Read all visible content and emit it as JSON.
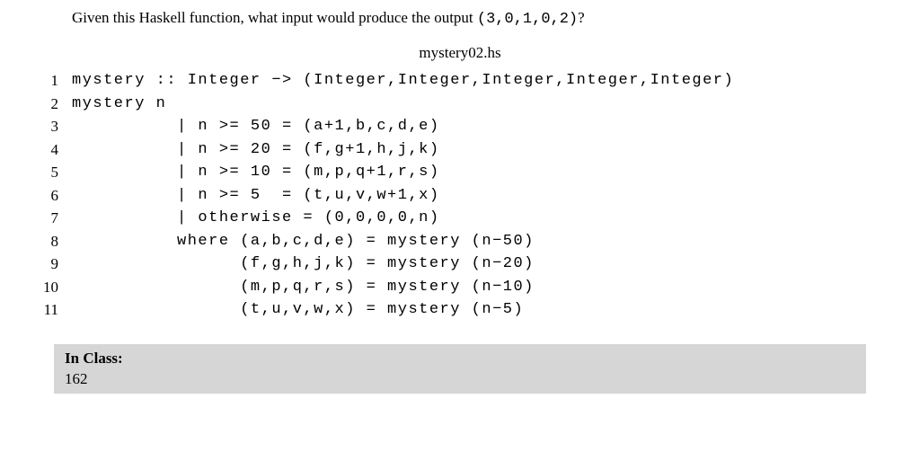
{
  "question": {
    "text_prefix": "Given this Haskell function, what input would produce the output ",
    "output_value": "(3,0,1,0,2)",
    "text_suffix": "?"
  },
  "filename": "mystery02.hs",
  "code": {
    "line_numbers": [
      "1",
      "2",
      "3",
      "4",
      "5",
      "6",
      "7",
      "8",
      "9",
      "10",
      "11"
    ],
    "lines": [
      "mystery :: Integer −> (Integer,Integer,Integer,Integer,Integer)",
      "mystery n",
      "          | n >= 50 = (a+1,b,c,d,e)",
      "          | n >= 20 = (f,g+1,h,j,k)",
      "          | n >= 10 = (m,p,q+1,r,s)",
      "          | n >= 5  = (t,u,v,w+1,x)",
      "          | otherwise = (0,0,0,0,n)",
      "          where (a,b,c,d,e) = mystery (n−50)",
      "                (f,g,h,j,k) = mystery (n−20)",
      "                (m,p,q,r,s) = mystery (n−10)",
      "                (t,u,v,w,x) = mystery (n−5)"
    ]
  },
  "in_class": {
    "label": "In Class:",
    "value": "162"
  }
}
